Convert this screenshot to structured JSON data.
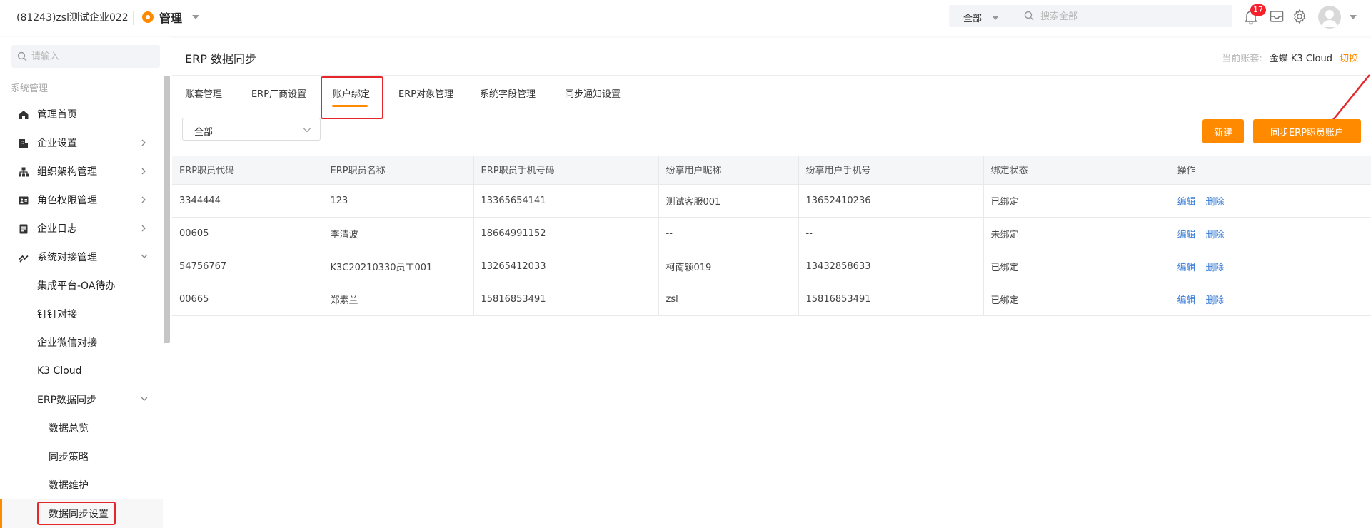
{
  "header": {
    "company": "(81243)zsl测试企业022",
    "app_name": "管理",
    "search_scope": "全部",
    "search_placeholder": "搜索全部",
    "notification_count": "17"
  },
  "sidebar": {
    "search_placeholder": "请输入",
    "section_title": "系统管理",
    "items": [
      {
        "label": "管理首页",
        "icon": "home-icon"
      },
      {
        "label": "企业设置",
        "icon": "building-icon"
      },
      {
        "label": "组织架构管理",
        "icon": "org-chart-icon"
      },
      {
        "label": "角色权限管理",
        "icon": "id-card-icon"
      },
      {
        "label": "企业日志",
        "icon": "log-icon"
      },
      {
        "label": "系统对接管理",
        "icon": "link-icon"
      },
      {
        "label": "集成平台-OA待办"
      },
      {
        "label": "钉钉对接"
      },
      {
        "label": "企业微信对接"
      },
      {
        "label": "K3 Cloud"
      },
      {
        "label": "ERP数据同步"
      },
      {
        "label": "数据总览"
      },
      {
        "label": "同步策略"
      },
      {
        "label": "数据维护"
      },
      {
        "label": "数据同步设置"
      }
    ]
  },
  "main": {
    "title": "ERP 数据同步",
    "account_label": "当前账套:",
    "account_value": "金蝶 K3 Cloud",
    "switch_label": "切换",
    "tabs": [
      "账套管理",
      "ERP厂商设置",
      "账户绑定",
      "ERP对象管理",
      "系统字段管理",
      "同步通知设置"
    ],
    "active_tab": "账户绑定",
    "filter_value": "全部",
    "new_button": "新建",
    "sync_button": "同步ERP职员账户",
    "table": {
      "columns": [
        "ERP职员代码",
        "ERP职员名称",
        "ERP职员手机号码",
        "纷享用户昵称",
        "纷享用户手机号",
        "绑定状态",
        "操作"
      ],
      "rows": [
        [
          "3344444",
          "123",
          "13365654141",
          "测试客服001",
          "13652410236",
          "已绑定"
        ],
        [
          "00605",
          "李清波",
          "18664991152",
          "--",
          "--",
          "未绑定"
        ],
        [
          "54756767",
          "K3C20210330员工001",
          "13265412033",
          "柯南颖019",
          "13432858633",
          "已绑定"
        ],
        [
          "00665",
          "郑素兰",
          "15816853491",
          "zsl",
          "15816853491",
          "已绑定"
        ]
      ],
      "edit_label": "编辑",
      "delete_label": "删除"
    }
  },
  "colors": {
    "accent": "#ff8a00",
    "highlight": "#e5262a",
    "link": "#3b7ed6"
  }
}
